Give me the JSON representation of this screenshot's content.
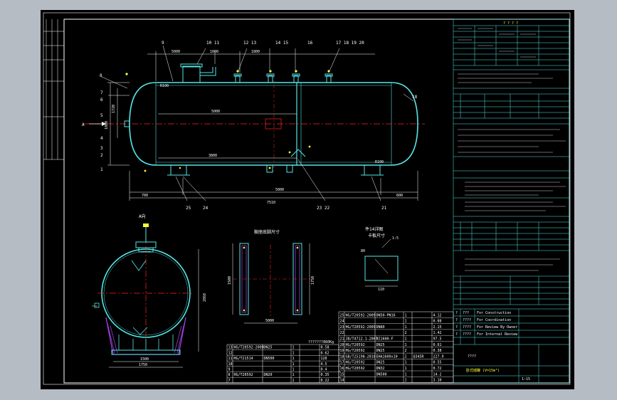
{
  "colors": {
    "background": "#b6bcc4",
    "paper": "#000000",
    "vessel": "#55e6e6",
    "frame_line": "#ffffff",
    "dimension": "#ffffff",
    "centerline": "#ff2222",
    "accent": "#ffff33",
    "hatch": "#aa44ee",
    "table_line": "#55e6e6"
  },
  "views": {
    "main": {
      "view_label": "A",
      "part_numbers": [
        "9",
        "10 11",
        "12 13",
        "14 15",
        "16",
        "17 18 19 20",
        "8",
        "7",
        "6",
        "5",
        "4",
        "3",
        "2",
        "1",
        "25",
        "24",
        "23 22",
        "21",
        "18"
      ],
      "dims": {
        "overall": "7510",
        "span": "5000",
        "left_end": "700",
        "right_end": "600",
        "nozzle_a": "5000",
        "nozzle_b": "1000",
        "nozzle_c": "1800",
        "inner": "5000",
        "inner2": "3800",
        "height_left": "1720",
        "height_main": "1800",
        "top1": "5000",
        "r1": "R100",
        "r2": "R100"
      }
    },
    "section_a": {
      "label": "A向",
      "dims": [
        "1500",
        "1750",
        "2868"
      ]
    },
    "saddle": {
      "title": "鞍座底脚尺寸",
      "dims": [
        "5000",
        "1500",
        "1750"
      ]
    },
    "detail": {
      "title": "件14详图",
      "subtitle": "卡板尺寸",
      "scale": "1:5",
      "dims": [
        "110",
        "80"
      ]
    },
    "weight_note": "???????860Kg"
  },
  "tables": {
    "spec_header": "? ? ? ?",
    "parts_right": [
      [
        "25",
        "HG/T20592-2009",
        "DN50-PN16",
        "1",
        "",
        "4.12"
      ],
      [
        "24",
        "",
        "",
        "1",
        "",
        "0.08"
      ],
      [
        "23",
        "HG/T20592-2009",
        "DN80",
        "1",
        "",
        "2.15"
      ],
      [
        "22",
        "",
        "",
        "2",
        "",
        "1.42"
      ],
      [
        "21",
        "JB/T4712.1-2007",
        "BI1600-F",
        "1",
        "",
        "97.5"
      ],
      [
        "20",
        "HG/T20592",
        "DN25",
        "1",
        "",
        "0.61"
      ],
      [
        "19",
        "HG/T20592",
        "DN25",
        "2",
        "",
        "0.38"
      ],
      [
        "18",
        "GB/T25198-2010",
        "EHA1600x10",
        "2",
        "Q345R",
        "227.9"
      ],
      [
        "17",
        "HG/T20592",
        "DN25",
        "1",
        "",
        "0.55"
      ],
      [
        "16",
        "HG/T20592",
        "DN32",
        "1",
        "",
        "0.72"
      ],
      [
        "15",
        "",
        "DN500",
        "1",
        "",
        "14.2"
      ],
      [
        "14",
        "",
        "",
        "1",
        "",
        "3.10"
      ]
    ],
    "parts_left": [
      [
        "13",
        "HG/T20592-2009",
        "DN25",
        "1",
        "",
        "0.58"
      ],
      [
        "12",
        "",
        "",
        "1",
        "",
        "0.62"
      ],
      [
        "11",
        "HG/T21514",
        "DN500",
        "1",
        "",
        "128"
      ],
      [
        "10",
        "",
        "",
        "1",
        "",
        "4.5"
      ],
      [
        "9",
        "",
        "",
        "1",
        "",
        "0.4"
      ],
      [
        "8",
        "HG/T20592",
        "DN20",
        "1",
        "",
        "0.35"
      ],
      [
        "7",
        "",
        "",
        "1",
        "",
        "0.22"
      ]
    ],
    "revision_rows": [
      [
        "?",
        "???",
        "For Construction"
      ],
      [
        "?",
        "????",
        "For Coordination"
      ],
      [
        "?",
        "????",
        "For Review By Owner"
      ],
      [
        "?",
        "????",
        "For Internal Review"
      ]
    ],
    "title_block": {
      "project": "????",
      "drawing_name": "卧式储罐 (V=15m³)",
      "sheet": "1:15"
    }
  }
}
